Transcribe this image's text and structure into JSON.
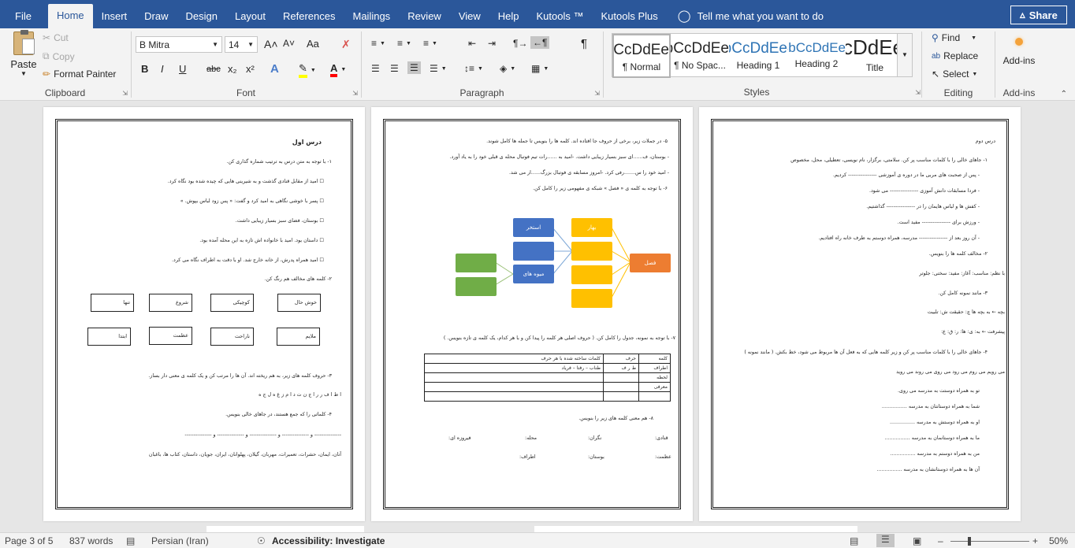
{
  "menubar": {
    "tabs": [
      "File",
      "Home",
      "Insert",
      "Draw",
      "Design",
      "Layout",
      "References",
      "Mailings",
      "Review",
      "View",
      "Help",
      "Kutools ™",
      "Kutools Plus"
    ],
    "tell_me": "Tell me what you want to do",
    "share": "Share"
  },
  "clipboard": {
    "paste": "Paste",
    "cut": "Cut",
    "copy": "Copy",
    "format_painter": "Format Painter",
    "label": "Clipboard"
  },
  "font": {
    "name": "B Mitra",
    "size": "14",
    "label": "Font",
    "bold": "B",
    "italic": "I",
    "underline": "U",
    "strike": "abc",
    "sub": "x₂",
    "sup": "x²",
    "grow": "A˄",
    "shrink": "A˅",
    "case": "Aa",
    "clear": "A"
  },
  "paragraph": {
    "label": "Paragraph",
    "pilcrow": "¶"
  },
  "styles": {
    "label": "Styles",
    "items": [
      {
        "preview": "AaBbCcDdEe",
        "name": "¶ Normal"
      },
      {
        "preview": "AaBbCcDdEe",
        "name": "¶ No Spac..."
      },
      {
        "preview": "AaBbCcDdEe",
        "name": "Heading 1"
      },
      {
        "preview": "AaBbCcDdEe",
        "name": "Heading 2"
      },
      {
        "preview": "AaBbCcDdEe",
        "name": "Title"
      }
    ]
  },
  "editing": {
    "find": "Find",
    "replace": "Replace",
    "select": "Select",
    "label": "Editing"
  },
  "addins": {
    "label": "Add-ins",
    "button": "Add-ins"
  },
  "colors": {
    "accent": "#2b579a",
    "highlight": "#ffff00",
    "font_color": "#ff0000",
    "blue_node": "#4472c4",
    "green_node": "#70ad47",
    "yellow_node": "#ffc000",
    "orange_node": "#ed7d31"
  },
  "page1": {
    "title": "درس اول",
    "lines": [
      "۱-   با توجه به متن درس به ترتیب شماره گذاری کن.",
      "☐  امید از مقابل قنادی گذشت و به شیرینی هایی که چیده شده بود نگاه کرد.",
      "☐  پسر با خوشی نگاهی به امید کرد و گفت: « پس زود لباس بپوش. »",
      "☐  بوستان، فضای سبز بسیار زیبایی داشت.",
      "☐  داستان بود. امید با خانواده اش تازه به این محله آمده بود.",
      "☐  امید همراه پدرش، از خانه خارج شد. او با دقت به اطراف نگاه می کرد.",
      "۲-   کلمه های مخالف هم رنگ کن."
    ],
    "boxes_row1": [
      "خوش حال",
      "کوچیکی",
      "شروع",
      "تنها"
    ],
    "boxes_row2": [
      "ملایم",
      "ناراحت",
      "عظمت",
      "ابتدا"
    ],
    "lines2": [
      "۳-   حروف کلمه های زیر، به هم ریخته اند. آن ها را مرتب کن و یک کلمه ی معنی دار بساز.",
      "ا ط ا ف ر          ر ا ج ن ت          د ا م ز غ          ه ل ج ه",
      "۴-   کلماتی را که جمع هستند، در جاهای خالی بنویس.",
      "--------------- و --------------- و --------------- و --------------- و ---------------",
      "آنان، ایمان، حشرات، تعمیرات، مهربان، گیلان، پهلوانان، ایران، جویان، داستان، کتاب ها، باغبان"
    ]
  },
  "page2": {
    "lines": [
      "۵-   در جملات زیر، برخی از حروف جا افتاده اند. کلمه ها را بنویس تا جمله ها کامل شوند.",
      "-   بوستان، ف......ای سبز بسیار زیبایی داشت.       -امید به ......رات تیم فوتبال محله ی قبلی خود را به یاد آورد.",
      "-   امید خود را س.......رفی کرد.         -امروز مسابقه ی فوتبال بزرگ......ار می شد.",
      "۶-   با توجه به کلمه ی « فصل » شبکه ی مفهومی زیر را کامل کن."
    ],
    "nodes": {
      "center": "فصل",
      "spring": "بهار",
      "pool": "استخر",
      "fruits": "میوه های تابستانی"
    },
    "q7": "۷-   با توجه به نمونه، جدول را کامل کن. ( حروف اصلی هر کلمه را پیدا کن و با هر کدام، یک کلمه ی تازه بنویس. )",
    "table": {
      "headers": [
        "کلمه",
        "حرف",
        "کلمات ساخته شده با هر حرف"
      ],
      "rows": [
        [
          "اطراف",
          "ط ر ف",
          "طناب – رفتا – فریاد"
        ],
        [
          "لحظه",
          "",
          ""
        ],
        [
          "معرفی",
          "",
          ""
        ],
        [
          "",
          "",
          ""
        ]
      ]
    },
    "q8": "۸-   هم معنی کلمه های زیر را بنویس.",
    "syn_row1": [
      "قنادی:",
      "نگران:",
      "محله:",
      "فیروزه ای:"
    ],
    "syn_row2": [
      "عظمت:",
      "بوستان:",
      "اطراف:"
    ]
  },
  "page3": {
    "title": "درس دوم",
    "lines": [
      "۱-   جاهای خالی را با کلمات مناسب پر کن.       سلامتی، برگزار، نام نویسی، تعطیلی، محل، مخصوص",
      "-   پس از صحبت های مربی ما در دوره ی آموزشی ---------------- کردیم.",
      "-   فردا مسابقات دانش آموزی ---------------- می شود.",
      "-   کفش ها و لباس هایمان را در ---------------- گذاشتیم.",
      "-   ورزش برای ---------------- مفید است.",
      "-   آن روز بعد از ---------------- مدرسه، همراه دوستم به طرف خانه راه افتادیم.",
      "۲-   مخالف کلمه ها را بنویس.",
      "با نظم:          مناسب:          آغاز:          مفید:          سختی:          جلوتر",
      "۳-   مانند نمونه کامل کن.",
      "بچه ← به بچه ها      چ: حقیقت      ش: تلبیت",
      "پیشرفت ← به:      ی:      ها:      ر:      ق:      ع:",
      "۴-   جاهای خالی را با کلمات مناسب پر کن و زیر کلمه هایی که به فعل آن ها مربوط می شود، خط بکش. ( مانند نمونه )",
      "می رویم       می روم       می رود       می روی       می روند       می روید"
    ],
    "bullets": [
      "تو به همراه دوستت به مدرسه می روی.",
      "شما به همراه دوستانتان به مدرسه ................",
      "او به همراه دوستش به مدرسه ................",
      "ما به همراه دوستانمان به مدرسه ................",
      "من به همراه دوستم به مدرسه ................",
      "آن ها به همراه دوستانشان به مدرسه ................"
    ]
  },
  "status": {
    "page": "Page 3 of 5",
    "words": "837 words",
    "language": "Persian (Iran)",
    "accessibility": "Accessibility: Investigate",
    "zoom": "50%"
  }
}
